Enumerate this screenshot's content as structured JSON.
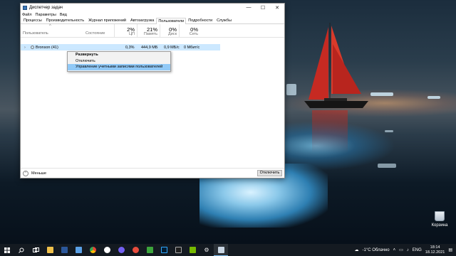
{
  "window": {
    "title": "Диспетчер задач",
    "controls": {
      "minimize": "—",
      "maximize": "☐",
      "close": "✕"
    }
  },
  "menu": [
    "Файл",
    "Параметры",
    "Вид"
  ],
  "tabs": [
    {
      "label": "Процессы",
      "active": false
    },
    {
      "label": "Производительность",
      "active": false
    },
    {
      "label": "Журнал приложений",
      "active": false
    },
    {
      "label": "Автозагрузка",
      "active": false
    },
    {
      "label": "Пользователи",
      "active": true
    },
    {
      "label": "Подробности",
      "active": false
    },
    {
      "label": "Службы",
      "active": false
    }
  ],
  "columns": {
    "user": "Пользователь",
    "status": "Состояние",
    "cpu": {
      "percent": "2%",
      "label": "ЦП"
    },
    "memory": {
      "percent": "21%",
      "label": "Память"
    },
    "disk": {
      "percent": "0%",
      "label": "Диск"
    },
    "network": {
      "percent": "0%",
      "label": "Сеть"
    }
  },
  "rows": [
    {
      "expander": "›",
      "name": "Bronson (41)",
      "cpu": "0,3%",
      "memory": "444,9 МБ",
      "disk": "0,9 МБ/с",
      "network": "0 Мбит/с"
    }
  ],
  "context_menu": {
    "items": [
      {
        "label": "Развернуть",
        "bold": true
      },
      {
        "label": "Отключить",
        "bold": false
      },
      {
        "label": "Управление учетными записями пользователей",
        "bold": false,
        "highlighted": true
      }
    ]
  },
  "footer": {
    "less_label": "Меньше",
    "end_button": "Отключить"
  },
  "desktop": {
    "recycle_bin_label": "Корзина"
  },
  "taskbar": {
    "apps": [
      "start-icon",
      "search-icon",
      "task-view-icon",
      "file-explorer-icon",
      "word-icon",
      "store-icon",
      "chrome-icon",
      "app-icon-1",
      "viber-icon",
      "app-icon-2",
      "app-icon-3",
      "photoshop-icon",
      "app-icon-4",
      "nvidia-icon",
      "settings-icon",
      "task-manager-icon"
    ],
    "weather": "-1°C  Облачно",
    "language": "ENG",
    "time": "18:14",
    "date": "18.12.2021"
  }
}
